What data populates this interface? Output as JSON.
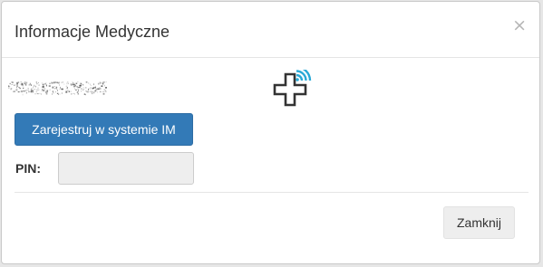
{
  "modal": {
    "title": "Informacje Medyczne",
    "close_symbol": "×"
  },
  "icons": {
    "medical": "medical-cross-wireless-icon",
    "close": "close-icon"
  },
  "colors": {
    "primary": "#337ab7",
    "icon_signal": "#29a9d6",
    "icon_cross": "#333333"
  },
  "actions": {
    "register_label": "Zarejestruj w systemie IM",
    "close_label": "Zamknij"
  },
  "form": {
    "pin_label": "PIN:",
    "pin_value": ""
  }
}
